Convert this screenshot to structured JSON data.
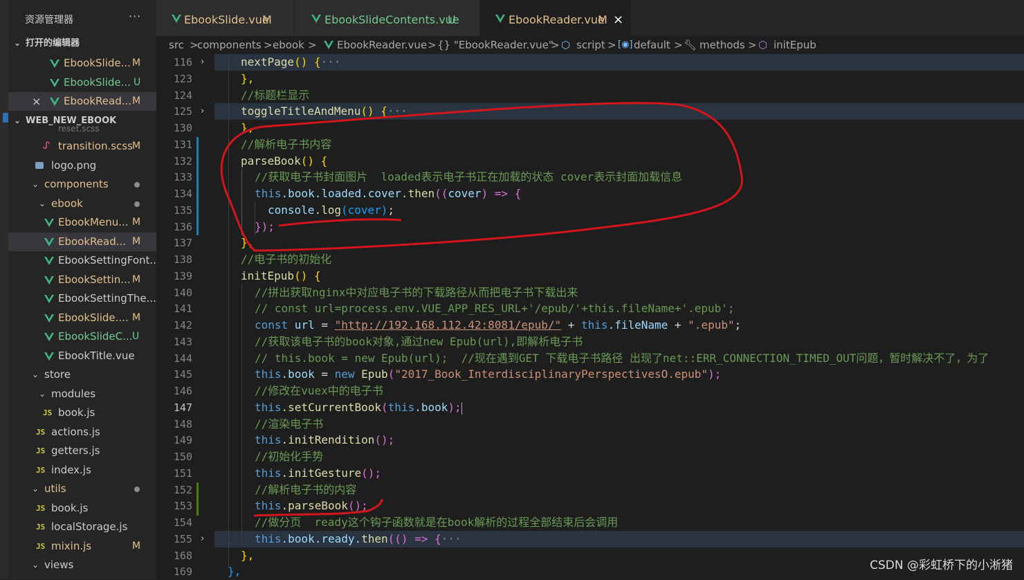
{
  "sidebar": {
    "title": "资源管理器",
    "more": "···",
    "open_editors_header": "打开的编辑器",
    "open_editors": [
      {
        "name": "EbookSlide...",
        "badge": "M"
      },
      {
        "name": "EbookSlide...",
        "badge": "U"
      },
      {
        "name": "EbookRead...",
        "badge": "M",
        "close": "×"
      }
    ],
    "project_header": "WEB_NEW_EBOOK",
    "tree": {
      "cut_item": "reset.scss",
      "transition": {
        "name": "transition.scss",
        "badge": "M"
      },
      "logo": "logo.png",
      "components": "components",
      "ebook": "ebook",
      "ebook_files": [
        {
          "name": "EbookMenu...",
          "badge": "M"
        },
        {
          "name": "EbookRead...",
          "badge": "M"
        },
        {
          "name": "EbookSettingFont...",
          "badge": ""
        },
        {
          "name": "EbookSettin...",
          "badge": "M"
        },
        {
          "name": "EbookSettingThe...",
          "badge": ""
        },
        {
          "name": "EbookSlide....",
          "badge": "M"
        },
        {
          "name": "EbookSlideC...",
          "badge": "U"
        },
        {
          "name": "EbookTitle.vue",
          "badge": ""
        }
      ],
      "store": "store",
      "modules": "modules",
      "book_js": "book.js",
      "actions": "actions.js",
      "getters": "getters.js",
      "index": "index.js",
      "utils": "utils",
      "utils_book": "book.js",
      "localstorage": "localStorage.js",
      "mixin": {
        "name": "mixin.js",
        "badge": "M"
      },
      "views": "views"
    }
  },
  "tabs": [
    {
      "label": "EbookSlide.vue",
      "badge": "M"
    },
    {
      "label": "EbookSlideContents.vue",
      "badge": "U"
    },
    {
      "label": "EbookReader.vue",
      "badge": "M",
      "close": "×"
    }
  ],
  "breadcrumb": {
    "items": [
      "src",
      "components",
      "ebook",
      "EbookReader.vue",
      "{} \"EbookReader.vue\"",
      "script",
      "default",
      "methods",
      "initEpub"
    ],
    "sep": ">",
    "js_icon": "V"
  },
  "editor": {
    "line_numbers": [
      "116",
      "123",
      "124",
      "125",
      "130",
      "131",
      "132",
      "133",
      "134",
      "135",
      "136",
      "137",
      "138",
      "139",
      "140",
      "141",
      "142",
      "143",
      "144",
      "145",
      "146",
      "147",
      "148",
      "149",
      "150",
      "151",
      "152",
      "153",
      "154",
      "155",
      "168",
      "169"
    ],
    "current_line": "147",
    "folded_lines": [
      "116",
      "125",
      "155"
    ],
    "fold_marker": "›",
    "ellipsis": "···",
    "code": {
      "l116_fn": "nextPage",
      "l116_rest": "() {",
      "l123": "},",
      "l124": "//标题栏显示",
      "l125_fn": "toggleTitleAndMenu",
      "l125_rest": "() {",
      "l130": "},",
      "l131": "//解析电子书内容",
      "l132_fn": "parseBook",
      "l132_rest": "() {",
      "l133": "//获取电子书封面图片  loaded表示电子书正在加载的状态 cover表示封面加载信息",
      "l134_this": "this",
      "l134_book": ".book.loaded.cover.",
      "l134_then": "then",
      "l134_p1": "((",
      "l134_cover": "cover",
      "l134_p2": ") => {",
      "l135_console": "console",
      "l135_log": ".log",
      "l135_arg": "(cover)",
      "l135_semi": ";",
      "l136": "});",
      "l137": "},",
      "l138": "//电子书的初始化",
      "l139_fn": "initEpub",
      "l139_rest": "() {",
      "l140": "//拼出获取nginx中对应电子书的下载路径从而把电子书下载出来",
      "l141": "// const url=process.env.VUE_APP_RES_URL+'/epub/'+this.fileName+'.epub';",
      "l142_const": "const",
      "l142_url": " url",
      "l142_eq": " = ",
      "l142_str": "\"http://192.168.112.42:8081/epub/\"",
      "l142_plus": " + ",
      "l142_this": "this",
      "l142_fn": ".fileName",
      "l142_plus2": " + ",
      "l142_ext": "\".epub\"",
      "l142_semi": ";",
      "l143": "//获取该电子书的book对象,通过new Epub(url),即解析电子书",
      "l144": "// this.book = new Epub(url);  //现在遇到GET 下载电子书路径 出现了net::ERR_CONNECTION_TIMED_OUT问题，暂时解决不了，为了",
      "l145_this": "this",
      "l145_book": ".book",
      "l145_eq": " = ",
      "l145_new": "new",
      "l145_cls": " Epub",
      "l145_p": "(",
      "l145_str": "\"2017_Book_InterdisciplinaryPerspectivesO.epub\"",
      "l145_end": ");",
      "l146": "//修改在vuex中的电子书",
      "l147_this": "this",
      "l147_fn": ".setCurrentBook",
      "l147_p": "(",
      "l147_this2": "this",
      "l147_book": ".book",
      "l147_end": ");",
      "l148": "//渲染电子书",
      "l149_this": "this",
      "l149_fn": ".initRendition",
      "l149_end": "();",
      "l150": "//初始化手势",
      "l151_this": "this",
      "l151_fn": ".initGesture",
      "l151_end": "();",
      "l152": "//解析电子书的内容",
      "l153_this": "this",
      "l153_fn": ".parseBook",
      "l153_end": "();",
      "l154": "//做分页  ready这个钩子函数就是在book解析的过程全部结束后会调用",
      "l155_this": "this",
      "l155_fn": ".book.ready.",
      "l155_then": "then",
      "l155_p": "(() => {",
      "l168": "},",
      "l169": "},"
    }
  },
  "watermark": "CSDN @彩虹桥下的小淅猪",
  "colors": {
    "annotation": "#d4161c",
    "vue_green": "#41b883",
    "accent": "#2f6fb4"
  }
}
